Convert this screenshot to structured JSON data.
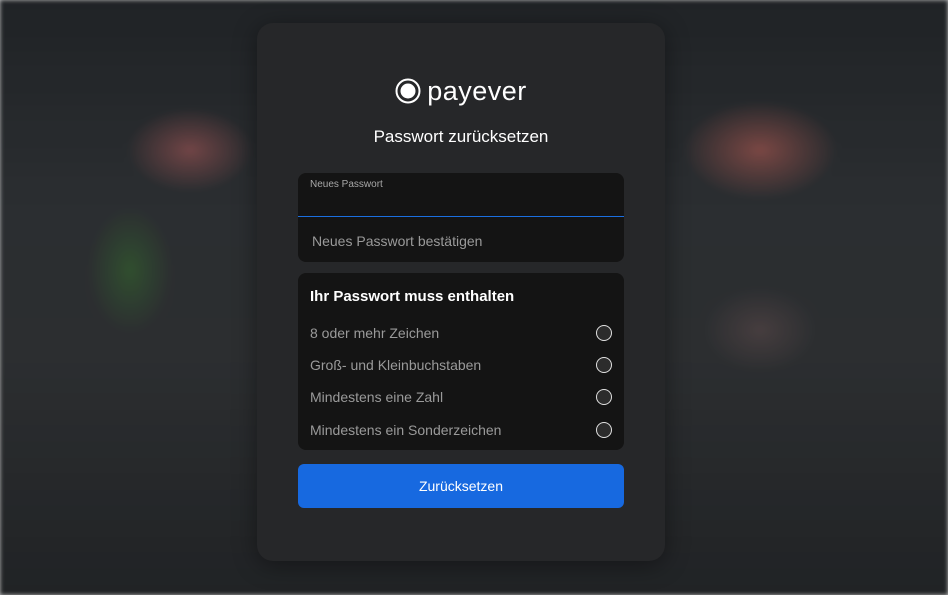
{
  "brand": {
    "name": "payever",
    "logo_icon": "payever-logo-icon"
  },
  "page": {
    "title": "Passwort zurücksetzen"
  },
  "form": {
    "new_password": {
      "label": "Neues Passwort",
      "value": ""
    },
    "confirm_password": {
      "placeholder": "Neues Passwort bestätigen",
      "value": ""
    }
  },
  "requirements": {
    "title": "Ihr Passwort muss enthalten",
    "items": [
      {
        "label": "8 oder mehr Zeichen",
        "met": false
      },
      {
        "label": "Groß- und Kleinbuchstaben",
        "met": false
      },
      {
        "label": "Mindestens eine Zahl",
        "met": false
      },
      {
        "label": "Mindestens ein Sonderzeichen",
        "met": false
      }
    ]
  },
  "actions": {
    "submit_label": "Zurücksetzen"
  },
  "colors": {
    "accent": "#1769e0",
    "card_bg": "#262729",
    "field_bg": "#141414"
  }
}
